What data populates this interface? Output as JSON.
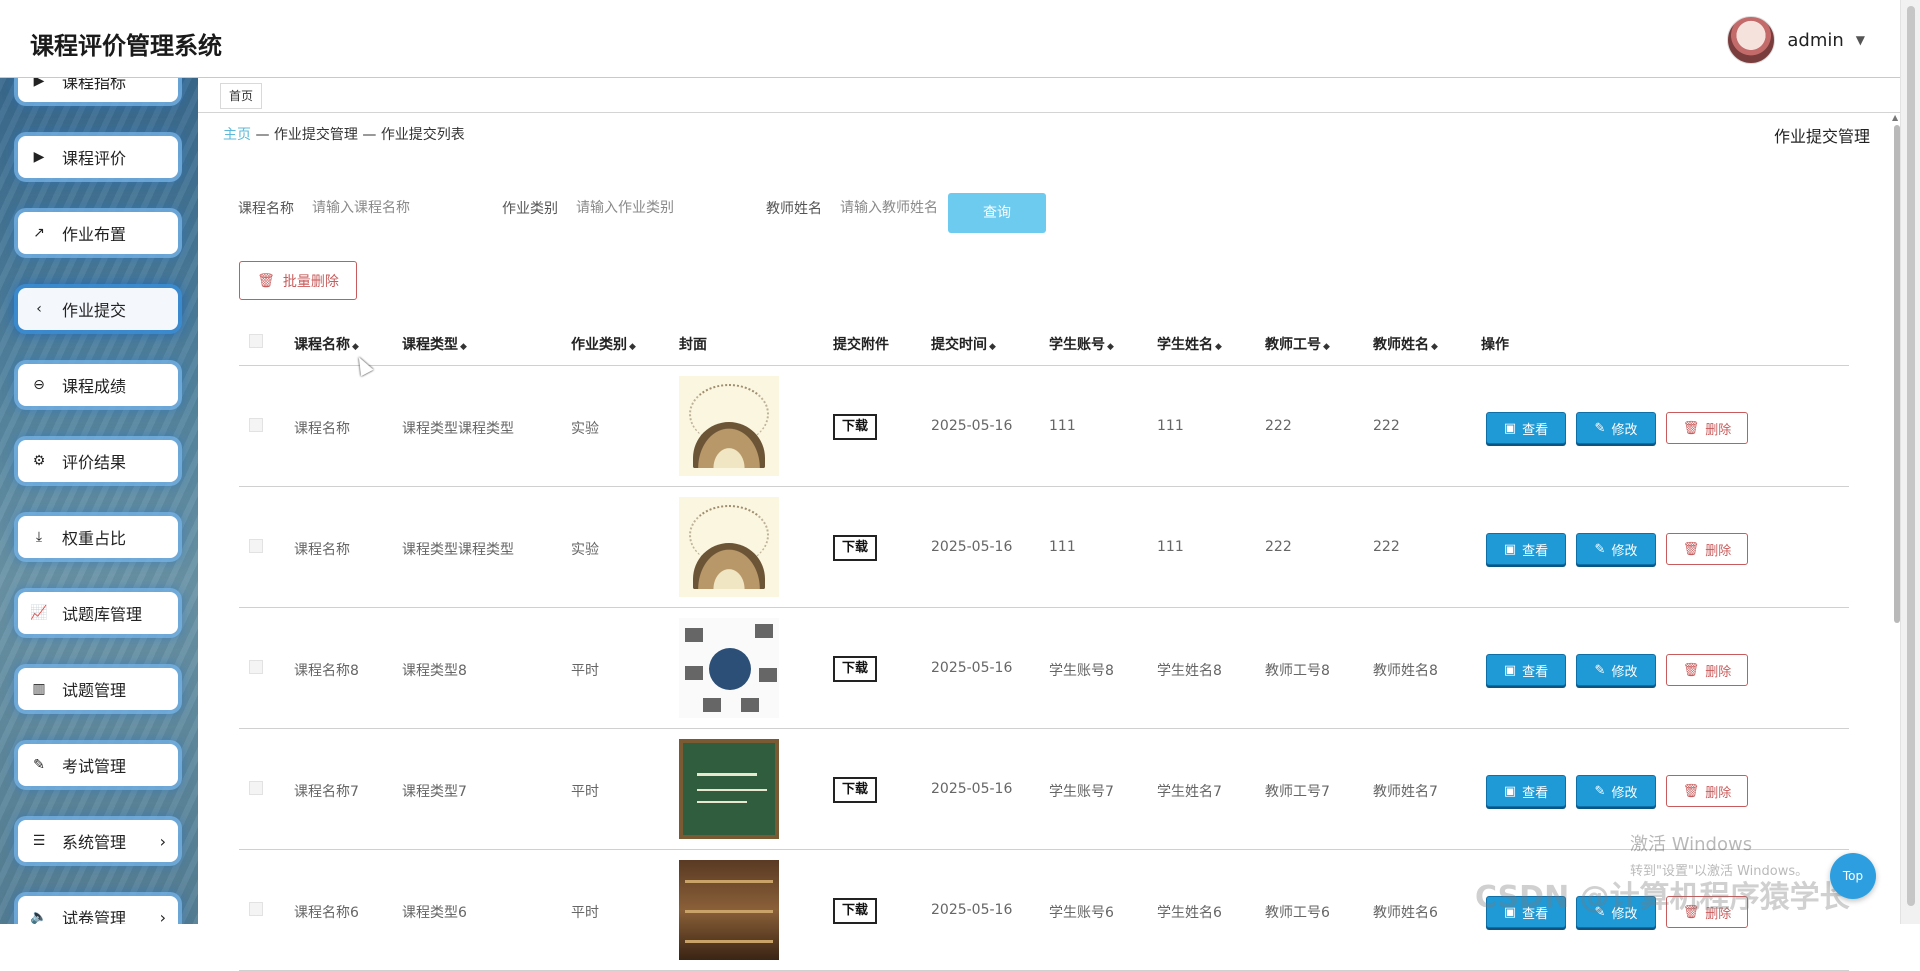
{
  "app": {
    "title": "课程评价管理系统"
  },
  "user": {
    "name": "admin"
  },
  "sidebar": {
    "items": [
      {
        "label": "课程指标",
        "icon": "play-triangle-icon",
        "active": false,
        "has_arrow": false
      },
      {
        "label": "课程评价",
        "icon": "play-triangle-icon",
        "active": false,
        "has_arrow": false
      },
      {
        "label": "作业布置",
        "icon": "trend-chart-icon",
        "active": false,
        "has_arrow": false
      },
      {
        "label": "作业提交",
        "icon": "chevron-left-icon",
        "active": true,
        "has_arrow": false
      },
      {
        "label": "课程成绩",
        "icon": "minus-circle-icon",
        "active": false,
        "has_arrow": false
      },
      {
        "label": "评价结果",
        "icon": "user-gear-icon",
        "active": false,
        "has_arrow": false
      },
      {
        "label": "权重占比",
        "icon": "download-doc-icon",
        "active": false,
        "has_arrow": false
      },
      {
        "label": "试题库管理",
        "icon": "line-chart-icon",
        "active": false,
        "has_arrow": false
      },
      {
        "label": "试题管理",
        "icon": "bar-chart-icon",
        "active": false,
        "has_arrow": false
      },
      {
        "label": "考试管理",
        "icon": "edit-doc-icon",
        "active": false,
        "has_arrow": false
      },
      {
        "label": "系统管理",
        "icon": "list-icon",
        "active": false,
        "has_arrow": true
      },
      {
        "label": "试卷管理",
        "icon": "volume-icon",
        "active": false,
        "has_arrow": true
      }
    ]
  },
  "tabs": [
    {
      "label": "首页"
    }
  ],
  "breadcrumb": {
    "home": "主页",
    "sep1": " — ",
    "level1": "作业提交管理",
    "sep2": " — ",
    "level2": "作业提交列表"
  },
  "page_title": "作业提交管理",
  "search": {
    "fields": [
      {
        "label": "课程名称",
        "placeholder": "请输入课程名称"
      },
      {
        "label": "作业类别",
        "placeholder": "请输入作业类别"
      },
      {
        "label": "教师姓名",
        "placeholder": "请输入教师姓名"
      }
    ],
    "query_label": "查询"
  },
  "batch_delete_label": "批量删除",
  "table": {
    "headers": {
      "course_name": "课程名称",
      "course_type": "课程类型",
      "homework_type": "作业类别",
      "cover": "封面",
      "attachment": "提交附件",
      "submit_time": "提交时间",
      "student_account": "学生账号",
      "student_name": "学生姓名",
      "teacher_id": "教师工号",
      "teacher_name": "教师姓名",
      "actions": "操作"
    },
    "download_label": "下载",
    "view_label": "查看",
    "edit_label": "修改",
    "delete_label": "删除",
    "rows": [
      {
        "course_name": "课程名称",
        "course_type": "课程类型课程类型",
        "homework_type": "实验",
        "cover": "book-cover",
        "submit_time": "2025-05-16",
        "student_account": "111",
        "student_name": "111",
        "teacher_id": "222",
        "teacher_name": "222"
      },
      {
        "course_name": "课程名称",
        "course_type": "课程类型课程类型",
        "homework_type": "实验",
        "cover": "book-cover",
        "submit_time": "2025-05-16",
        "student_account": "111",
        "student_name": "111",
        "teacher_id": "222",
        "teacher_name": "222"
      },
      {
        "course_name": "课程名称8",
        "course_type": "课程类型8",
        "homework_type": "平时",
        "cover": "diagram-cover",
        "submit_time": "2025-05-16",
        "student_account": "学生账号8",
        "student_name": "学生姓名8",
        "teacher_id": "教师工号8",
        "teacher_name": "教师姓名8"
      },
      {
        "course_name": "课程名称7",
        "course_type": "课程类型7",
        "homework_type": "平时",
        "cover": "blackboard-cover",
        "submit_time": "2025-05-16",
        "student_account": "学生账号7",
        "student_name": "学生姓名7",
        "teacher_id": "教师工号7",
        "teacher_name": "教师姓名7"
      },
      {
        "course_name": "课程名称6",
        "course_type": "课程类型6",
        "homework_type": "平时",
        "cover": "library-cover",
        "submit_time": "2025-05-16",
        "student_account": "学生账号6",
        "student_name": "学生姓名6",
        "teacher_id": "教师工号6",
        "teacher_name": "教师姓名6"
      }
    ]
  },
  "overlays": {
    "windows_activation_line1": "激活 Windows",
    "windows_activation_line2": "转到\"设置\"以激活 Windows。",
    "csdn_watermark": "CSDN @计算机程序猿学长",
    "top_button": "Top"
  },
  "colors": {
    "accent": "#1f9ad6",
    "query": "#6dcbef",
    "danger": "#c85b5b",
    "link": "#5cb9da"
  }
}
